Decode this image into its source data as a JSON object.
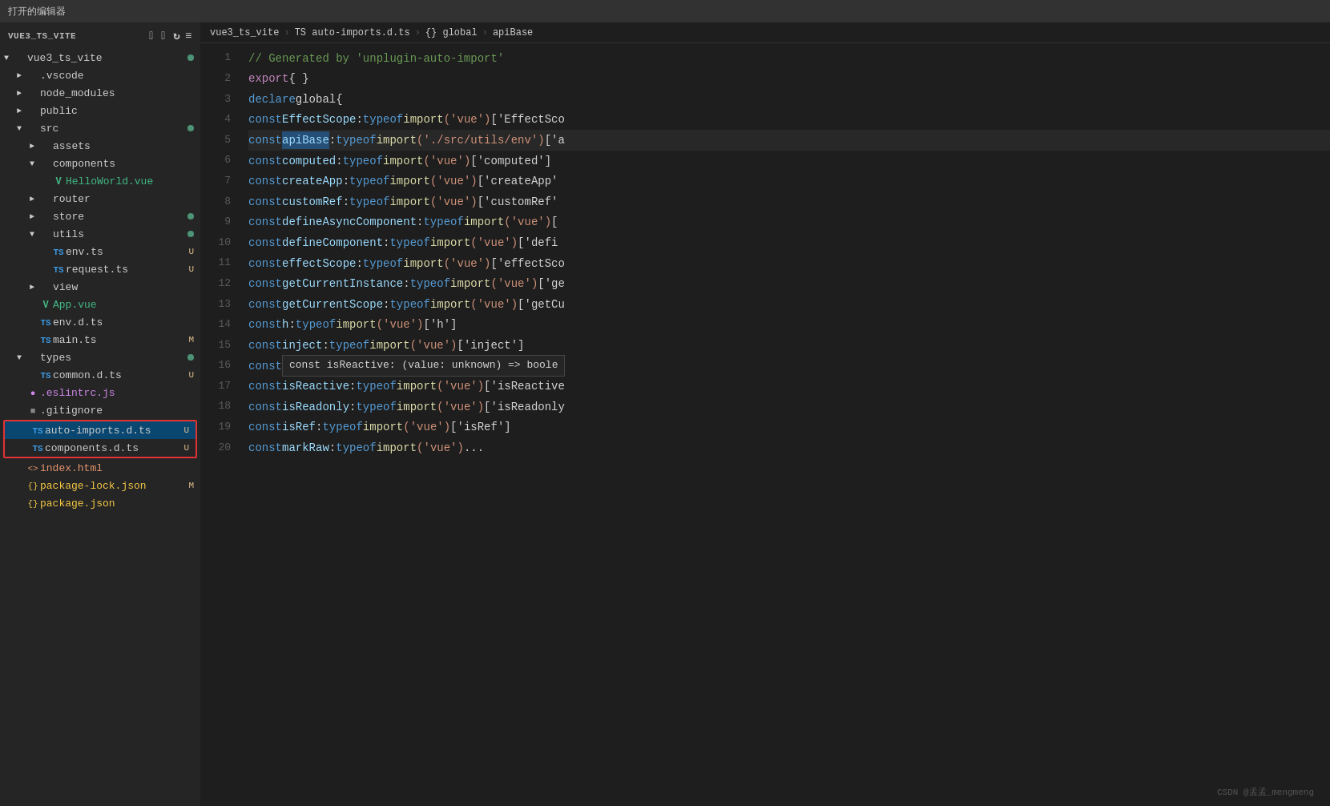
{
  "titlebar": {
    "label": "打开的编辑器"
  },
  "sidebar": {
    "header": "VUE3_TS_VITE",
    "icons": [
      "new-file",
      "new-folder",
      "refresh",
      "collapse"
    ],
    "tree": [
      {
        "id": "vue3_ts_vite_root",
        "label": "vue3_ts_vite",
        "type": "folder",
        "open": true,
        "indent": 0,
        "dot": true
      },
      {
        "id": "vscode",
        "label": ".vscode",
        "type": "folder",
        "open": false,
        "indent": 1
      },
      {
        "id": "node_modules",
        "label": "node_modules",
        "type": "folder",
        "open": false,
        "indent": 1
      },
      {
        "id": "public",
        "label": "public",
        "type": "folder",
        "open": false,
        "indent": 1
      },
      {
        "id": "src",
        "label": "src",
        "type": "folder",
        "open": true,
        "indent": 1,
        "dot": true
      },
      {
        "id": "assets",
        "label": "assets",
        "type": "folder",
        "open": false,
        "indent": 2
      },
      {
        "id": "components",
        "label": "components",
        "type": "folder",
        "open": true,
        "indent": 2
      },
      {
        "id": "HelloWorld_vue",
        "label": "HelloWorld.vue",
        "type": "vue",
        "indent": 3
      },
      {
        "id": "router",
        "label": "router",
        "type": "folder",
        "open": false,
        "indent": 2
      },
      {
        "id": "store",
        "label": "store",
        "type": "folder",
        "open": false,
        "indent": 2,
        "dot": true
      },
      {
        "id": "utils",
        "label": "utils",
        "type": "folder",
        "open": true,
        "indent": 2,
        "dot": true
      },
      {
        "id": "env_ts",
        "label": "env.ts",
        "type": "ts",
        "indent": 3,
        "badge": "U"
      },
      {
        "id": "request_ts",
        "label": "request.ts",
        "type": "ts",
        "indent": 3,
        "badge": "U"
      },
      {
        "id": "view",
        "label": "view",
        "type": "folder",
        "open": false,
        "indent": 2
      },
      {
        "id": "App_vue",
        "label": "App.vue",
        "type": "vue",
        "indent": 2
      },
      {
        "id": "env_d_ts",
        "label": "env.d.ts",
        "type": "ts",
        "indent": 2
      },
      {
        "id": "main_ts",
        "label": "main.ts",
        "type": "ts",
        "indent": 2,
        "badge": "M"
      },
      {
        "id": "types",
        "label": "types",
        "type": "folder",
        "open": true,
        "indent": 1,
        "dot": true
      },
      {
        "id": "common_d_ts",
        "label": "common.d.ts",
        "type": "ts",
        "indent": 2,
        "badge": "U"
      },
      {
        "id": "eslintrc_js",
        "label": ".eslintrc.js",
        "type": "eslint",
        "indent": 1
      },
      {
        "id": "gitignore",
        "label": ".gitignore",
        "type": "file",
        "indent": 1
      },
      {
        "id": "auto_imports_d_ts",
        "label": "auto-imports.d.ts",
        "type": "ts",
        "indent": 1,
        "badge": "U",
        "selected": true
      },
      {
        "id": "components_d_ts",
        "label": "components.d.ts",
        "type": "ts",
        "indent": 1,
        "badge": "U",
        "redbox": true
      },
      {
        "id": "index_html",
        "label": "index.html",
        "type": "html",
        "indent": 1
      },
      {
        "id": "package_lock_json",
        "label": "package-lock.json",
        "type": "json",
        "indent": 1,
        "badge": "M"
      },
      {
        "id": "package_json",
        "label": "package.json",
        "type": "json",
        "indent": 1
      }
    ]
  },
  "breadcrumb": {
    "parts": [
      "vue3_ts_vite",
      "TS auto-imports.d.ts",
      "{} global",
      "apiBase"
    ]
  },
  "editor": {
    "lines": [
      {
        "num": 1,
        "tokens": [
          {
            "text": "// Generated by 'unplugin-auto-import'",
            "cls": "s-comment"
          }
        ]
      },
      {
        "num": 2,
        "tokens": [
          {
            "text": "export",
            "cls": "s-import"
          },
          {
            "text": " ",
            "cls": ""
          },
          {
            "text": "{ }",
            "cls": "s-white"
          }
        ]
      },
      {
        "num": 3,
        "tokens": [
          {
            "text": "declare",
            "cls": "s-keyword"
          },
          {
            "text": " global ",
            "cls": "s-white"
          },
          {
            "text": "{",
            "cls": "s-white"
          }
        ]
      },
      {
        "num": 4,
        "tokens": [
          {
            "text": "    const",
            "cls": "s-keyword"
          },
          {
            "text": " EffectScope",
            "cls": "s-prop"
          },
          {
            "text": ":",
            "cls": "s-white"
          },
          {
            "text": " typeof",
            "cls": "s-keyword"
          },
          {
            "text": " import",
            "cls": "s-yellow"
          },
          {
            "text": "('vue')",
            "cls": "s-string"
          },
          {
            "text": "['EffectSco",
            "cls": "s-white"
          }
        ]
      },
      {
        "num": 5,
        "tokens": [
          {
            "text": "    const",
            "cls": "s-keyword"
          },
          {
            "text": " ",
            "cls": ""
          },
          {
            "text": "apiBase",
            "cls": "s-prop s-highlight"
          },
          {
            "text": ":",
            "cls": "s-white"
          },
          {
            "text": " typeof",
            "cls": "s-keyword"
          },
          {
            "text": " import",
            "cls": "s-yellow"
          },
          {
            "text": "('./src/utils/env')",
            "cls": "s-string"
          },
          {
            "text": "['a",
            "cls": "s-white"
          }
        ],
        "highlighted": true
      },
      {
        "num": 6,
        "tokens": [
          {
            "text": "    const",
            "cls": "s-keyword"
          },
          {
            "text": " computed",
            "cls": "s-prop"
          },
          {
            "text": ":",
            "cls": "s-white"
          },
          {
            "text": " typeof",
            "cls": "s-keyword"
          },
          {
            "text": " import",
            "cls": "s-yellow"
          },
          {
            "text": "('vue')",
            "cls": "s-string"
          },
          {
            "text": "['computed']",
            "cls": "s-white"
          }
        ]
      },
      {
        "num": 7,
        "tokens": [
          {
            "text": "    const",
            "cls": "s-keyword"
          },
          {
            "text": " createApp",
            "cls": "s-prop"
          },
          {
            "text": ":",
            "cls": "s-white"
          },
          {
            "text": " typeof",
            "cls": "s-keyword"
          },
          {
            "text": " import",
            "cls": "s-yellow"
          },
          {
            "text": "('vue')",
            "cls": "s-string"
          },
          {
            "text": "['createApp'",
            "cls": "s-white"
          }
        ]
      },
      {
        "num": 8,
        "tokens": [
          {
            "text": "    const",
            "cls": "s-keyword"
          },
          {
            "text": " customRef",
            "cls": "s-prop"
          },
          {
            "text": ":",
            "cls": "s-white"
          },
          {
            "text": " typeof",
            "cls": "s-keyword"
          },
          {
            "text": " import",
            "cls": "s-yellow"
          },
          {
            "text": "('vue')",
            "cls": "s-string"
          },
          {
            "text": "['customRef'",
            "cls": "s-white"
          }
        ]
      },
      {
        "num": 9,
        "tokens": [
          {
            "text": "    const",
            "cls": "s-keyword"
          },
          {
            "text": " defineAsyncComponent",
            "cls": "s-prop"
          },
          {
            "text": ":",
            "cls": "s-white"
          },
          {
            "text": " typeof",
            "cls": "s-keyword"
          },
          {
            "text": " import",
            "cls": "s-yellow"
          },
          {
            "text": "('vue')",
            "cls": "s-string"
          },
          {
            "text": "[",
            "cls": "s-white"
          }
        ]
      },
      {
        "num": 10,
        "tokens": [
          {
            "text": "    const",
            "cls": "s-keyword"
          },
          {
            "text": " defineComponent",
            "cls": "s-prop"
          },
          {
            "text": ":",
            "cls": "s-white"
          },
          {
            "text": " typeof",
            "cls": "s-keyword"
          },
          {
            "text": " import",
            "cls": "s-yellow"
          },
          {
            "text": "('vue')",
            "cls": "s-string"
          },
          {
            "text": "['defi",
            "cls": "s-white"
          }
        ]
      },
      {
        "num": 11,
        "tokens": [
          {
            "text": "    const",
            "cls": "s-keyword"
          },
          {
            "text": " effectScope",
            "cls": "s-prop"
          },
          {
            "text": ":",
            "cls": "s-white"
          },
          {
            "text": " typeof",
            "cls": "s-keyword"
          },
          {
            "text": " import",
            "cls": "s-yellow"
          },
          {
            "text": "('vue')",
            "cls": "s-string"
          },
          {
            "text": "['effectSco",
            "cls": "s-white"
          }
        ]
      },
      {
        "num": 12,
        "tokens": [
          {
            "text": "    const",
            "cls": "s-keyword"
          },
          {
            "text": " getCurrentInstance",
            "cls": "s-prop"
          },
          {
            "text": ":",
            "cls": "s-white"
          },
          {
            "text": " typeof",
            "cls": "s-keyword"
          },
          {
            "text": " import",
            "cls": "s-yellow"
          },
          {
            "text": "('vue')",
            "cls": "s-string"
          },
          {
            "text": "['ge",
            "cls": "s-white"
          }
        ]
      },
      {
        "num": 13,
        "tokens": [
          {
            "text": "    const",
            "cls": "s-keyword"
          },
          {
            "text": " getCurrentScope",
            "cls": "s-prop"
          },
          {
            "text": ":",
            "cls": "s-white"
          },
          {
            "text": " typeof",
            "cls": "s-keyword"
          },
          {
            "text": " import",
            "cls": "s-yellow"
          },
          {
            "text": "('vue')",
            "cls": "s-string"
          },
          {
            "text": "['getCu",
            "cls": "s-white"
          }
        ]
      },
      {
        "num": 14,
        "tokens": [
          {
            "text": "    const",
            "cls": "s-keyword"
          },
          {
            "text": " h",
            "cls": "s-prop"
          },
          {
            "text": ":",
            "cls": "s-white"
          },
          {
            "text": " typeof",
            "cls": "s-keyword"
          },
          {
            "text": " import",
            "cls": "s-yellow"
          },
          {
            "text": "('vue')",
            "cls": "s-string"
          },
          {
            "text": "['h']",
            "cls": "s-white"
          }
        ]
      },
      {
        "num": 15,
        "tokens": [
          {
            "text": "    const",
            "cls": "s-keyword"
          },
          {
            "text": " inject",
            "cls": "s-prop"
          },
          {
            "text": ":",
            "cls": "s-white"
          },
          {
            "text": " typeof",
            "cls": "s-keyword"
          },
          {
            "text": " import",
            "cls": "s-yellow"
          },
          {
            "text": "('vue')",
            "cls": "s-string"
          },
          {
            "text": "['inject']",
            "cls": "s-white"
          }
        ]
      },
      {
        "num": 16,
        "tokens": [
          {
            "text": "    const",
            "cls": "s-keyword"
          },
          {
            "text": "  ",
            "cls": ""
          },
          {
            "text": "const isReactive: (value: unknown) => boole",
            "cls": "tooltip-inline"
          }
        ]
      },
      {
        "num": 17,
        "tokens": [
          {
            "text": "    const",
            "cls": "s-keyword"
          },
          {
            "text": " isReactive",
            "cls": "s-prop"
          },
          {
            "text": ":",
            "cls": "s-white"
          },
          {
            "text": " typeof",
            "cls": "s-keyword"
          },
          {
            "text": " import",
            "cls": "s-yellow"
          },
          {
            "text": "('vue')",
            "cls": "s-string"
          },
          {
            "text": "['isReactive",
            "cls": "s-white"
          }
        ]
      },
      {
        "num": 18,
        "tokens": [
          {
            "text": "    const",
            "cls": "s-keyword"
          },
          {
            "text": " isReadonly",
            "cls": "s-prop"
          },
          {
            "text": ":",
            "cls": "s-white"
          },
          {
            "text": " typeof",
            "cls": "s-keyword"
          },
          {
            "text": " import",
            "cls": "s-yellow"
          },
          {
            "text": "('vue')",
            "cls": "s-string"
          },
          {
            "text": "['isReadonly",
            "cls": "s-white"
          }
        ]
      },
      {
        "num": 19,
        "tokens": [
          {
            "text": "    const",
            "cls": "s-keyword"
          },
          {
            "text": " isRef",
            "cls": "s-prop"
          },
          {
            "text": ":",
            "cls": "s-white"
          },
          {
            "text": " typeof",
            "cls": "s-keyword"
          },
          {
            "text": " import",
            "cls": "s-yellow"
          },
          {
            "text": "('vue')",
            "cls": "s-string"
          },
          {
            "text": "['isRef']",
            "cls": "s-white"
          }
        ]
      },
      {
        "num": 20,
        "tokens": [
          {
            "text": "    const",
            "cls": "s-keyword"
          },
          {
            "text": " markRaw",
            "cls": "s-prop"
          },
          {
            "text": ":",
            "cls": "s-white"
          },
          {
            "text": " typeof",
            "cls": "s-keyword"
          },
          {
            "text": " import",
            "cls": "s-yellow"
          },
          {
            "text": "('vue')",
            "cls": "s-string"
          },
          {
            "text": "...",
            "cls": "s-white"
          }
        ]
      }
    ]
  },
  "watermark": "CSDN @孟孟_mengmeng"
}
